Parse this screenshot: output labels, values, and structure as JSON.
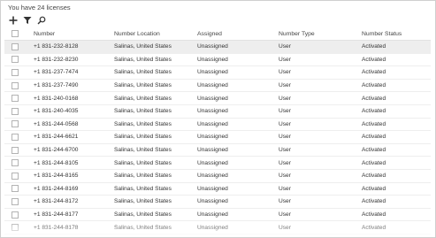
{
  "license_text": "You have 24 licenses",
  "toolbar": {
    "icons": [
      "add-icon",
      "filter-icon",
      "search-icon"
    ]
  },
  "table": {
    "headers": {
      "number": "Number",
      "location": "Number Location",
      "assigned": "Assigned",
      "type": "Number Type",
      "status": "Number Status"
    },
    "rows": [
      {
        "number": "+1 831-232-8128",
        "location": "Salinas, United States",
        "assigned": "Unassigned",
        "type": "User",
        "status": "Activated",
        "selected": true
      },
      {
        "number": "+1 831-232-8230",
        "location": "Salinas, United States",
        "assigned": "Unassigned",
        "type": "User",
        "status": "Activated"
      },
      {
        "number": "+1 831-237-7474",
        "location": "Salinas, United States",
        "assigned": "Unassigned",
        "type": "User",
        "status": "Activated"
      },
      {
        "number": "+1 831-237-7490",
        "location": "Salinas, United States",
        "assigned": "Unassigned",
        "type": "User",
        "status": "Activated"
      },
      {
        "number": "+1 831-240-0168",
        "location": "Salinas, United States",
        "assigned": "Unassigned",
        "type": "User",
        "status": "Activated"
      },
      {
        "number": "+1 831-240-4035",
        "location": "Salinas, United States",
        "assigned": "Unassigned",
        "type": "User",
        "status": "Activated"
      },
      {
        "number": "+1 831-244-0568",
        "location": "Salinas, United States",
        "assigned": "Unassigned",
        "type": "User",
        "status": "Activated"
      },
      {
        "number": "+1 831-244-6621",
        "location": "Salinas, United States",
        "assigned": "Unassigned",
        "type": "User",
        "status": "Activated"
      },
      {
        "number": "+1 831-244-6700",
        "location": "Salinas, United States",
        "assigned": "Unassigned",
        "type": "User",
        "status": "Activated"
      },
      {
        "number": "+1 831-244-8105",
        "location": "Salinas, United States",
        "assigned": "Unassigned",
        "type": "User",
        "status": "Activated"
      },
      {
        "number": "+1 831-244-8165",
        "location": "Salinas, United States",
        "assigned": "Unassigned",
        "type": "User",
        "status": "Activated"
      },
      {
        "number": "+1 831-244-8169",
        "location": "Salinas, United States",
        "assigned": "Unassigned",
        "type": "User",
        "status": "Activated"
      },
      {
        "number": "+1 831-244-8172",
        "location": "Salinas, United States",
        "assigned": "Unassigned",
        "type": "User",
        "status": "Activated"
      },
      {
        "number": "+1 831-244-8177",
        "location": "Salinas, United States",
        "assigned": "Unassigned",
        "type": "User",
        "status": "Activated"
      },
      {
        "number": "+1 831-244-8178",
        "location": "Salinas, United States",
        "assigned": "Unassigned",
        "type": "User",
        "status": "Activated"
      }
    ]
  }
}
